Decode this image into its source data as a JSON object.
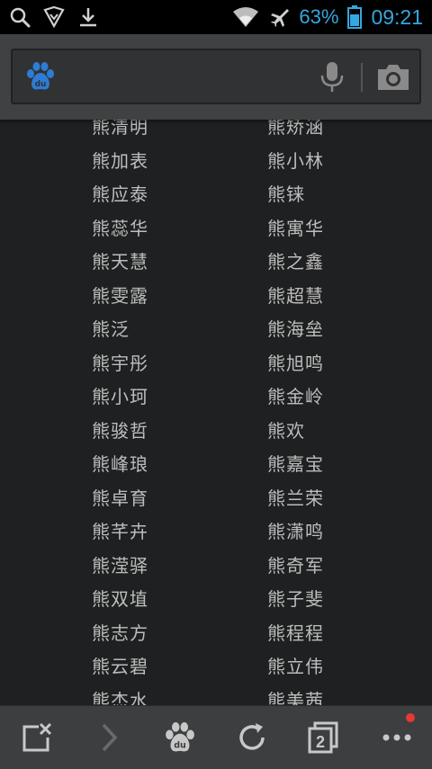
{
  "status_bar": {
    "battery_percent": "63%",
    "time": "09:21",
    "accent_color": "#35a7e0",
    "icons": [
      "search-icon",
      "shield-icon",
      "download-icon",
      "wifi-icon",
      "airplane-icon",
      "battery-icon"
    ]
  },
  "search": {
    "logo": "baidu-paw-logo",
    "logo_text": "du",
    "value": "",
    "icons": [
      "microphone-icon",
      "camera-icon"
    ]
  },
  "results": {
    "rows": [
      {
        "left": "熊清明",
        "right": "熊矫涵"
      },
      {
        "left": "熊加表",
        "right": "熊小林"
      },
      {
        "left": "熊应泰",
        "right": "熊铼"
      },
      {
        "left": "熊蕊华",
        "right": "熊寓华"
      },
      {
        "left": "熊天慧",
        "right": "熊之鑫"
      },
      {
        "left": "熊雯露",
        "right": "熊超慧"
      },
      {
        "left": "熊泛",
        "right": "熊海垒"
      },
      {
        "left": "熊宇彤",
        "right": "熊旭鸣"
      },
      {
        "left": "熊小珂",
        "right": "熊金岭"
      },
      {
        "left": "熊骏哲",
        "right": "熊欢"
      },
      {
        "left": "熊峰琅",
        "right": "熊嘉宝"
      },
      {
        "left": "熊卓育",
        "right": "熊兰荣"
      },
      {
        "left": "熊芊卉",
        "right": "熊潇鸣"
      },
      {
        "left": "熊滢驿",
        "right": "熊奇军"
      },
      {
        "left": "熊双埴",
        "right": "熊子斐"
      },
      {
        "left": "熊志方",
        "right": "熊程程"
      },
      {
        "left": "熊云碧",
        "right": "熊立伟"
      },
      {
        "left": "熊杰水",
        "right": "熊美茜"
      }
    ]
  },
  "toolbar": {
    "tab_count": "2",
    "logo_text": "du",
    "icons": [
      "close-tab-icon",
      "forward-icon",
      "baidu-home-icon",
      "refresh-icon",
      "tabs-icon",
      "more-icon"
    ],
    "notification_color": "#e53935"
  }
}
